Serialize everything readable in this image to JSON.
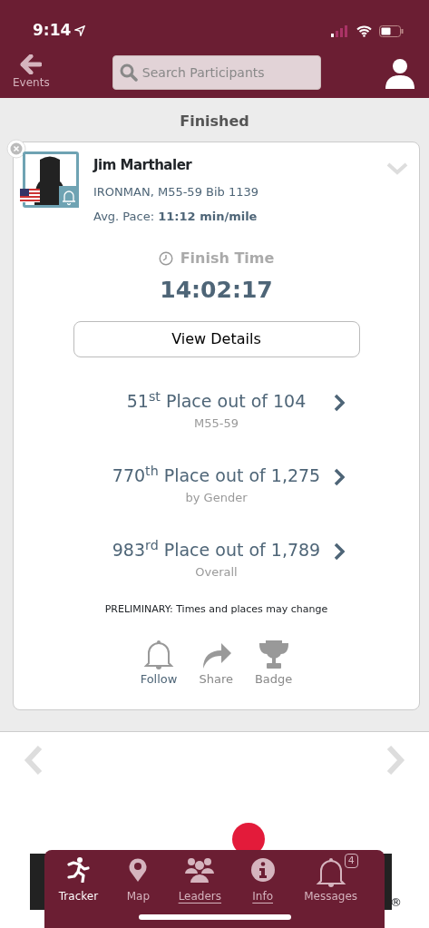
{
  "status_bar": {
    "time": "9:14"
  },
  "header": {
    "back_label": "Events",
    "search": {
      "placeholder": "Search Participants"
    }
  },
  "section_title": "Finished",
  "athlete": {
    "name": "Jim Marthaler",
    "division": "IRONMAN, M55-59 Bib 1139",
    "pace_label": "Avg. Pace:",
    "pace_value": "11:12 min/mile",
    "finish_label": "Finish Time",
    "finish_time": "14:02:17",
    "details_button": "View Details",
    "places": [
      {
        "text": "51$^{st}$ Place out of 104",
        "sub": "M55-59"
      },
      {
        "text": "770$^{th}$ Place out of 1,275",
        "sub": "by Gender"
      },
      {
        "text": "983$^{rd}$ Place out of 1,789",
        "sub": "Overall"
      }
    ],
    "note": "PRELIMINARY: Times and places may change",
    "actions": [
      {
        "kind": "bell",
        "label": "Follow",
        "active": true
      },
      {
        "kind": "share",
        "label": "Share",
        "active": false
      },
      {
        "kind": "trophy",
        "label": "Badge",
        "active": false
      }
    ]
  },
  "ad": {
    "mark": "®"
  },
  "tab_bar": [
    {
      "kind": "runner",
      "label": "Tracker",
      "selected": true,
      "underlined": false
    },
    {
      "kind": "pin",
      "label": "Map",
      "selected": false,
      "underlined": false
    },
    {
      "kind": "group",
      "label": "Leaders",
      "selected": false,
      "underlined": true
    },
    {
      "kind": "info",
      "label": "Info",
      "selected": false,
      "underlined": true
    },
    {
      "kind": "bell",
      "label": "Messages",
      "selected": false,
      "underlined": false,
      "badge": "4"
    }
  ]
}
